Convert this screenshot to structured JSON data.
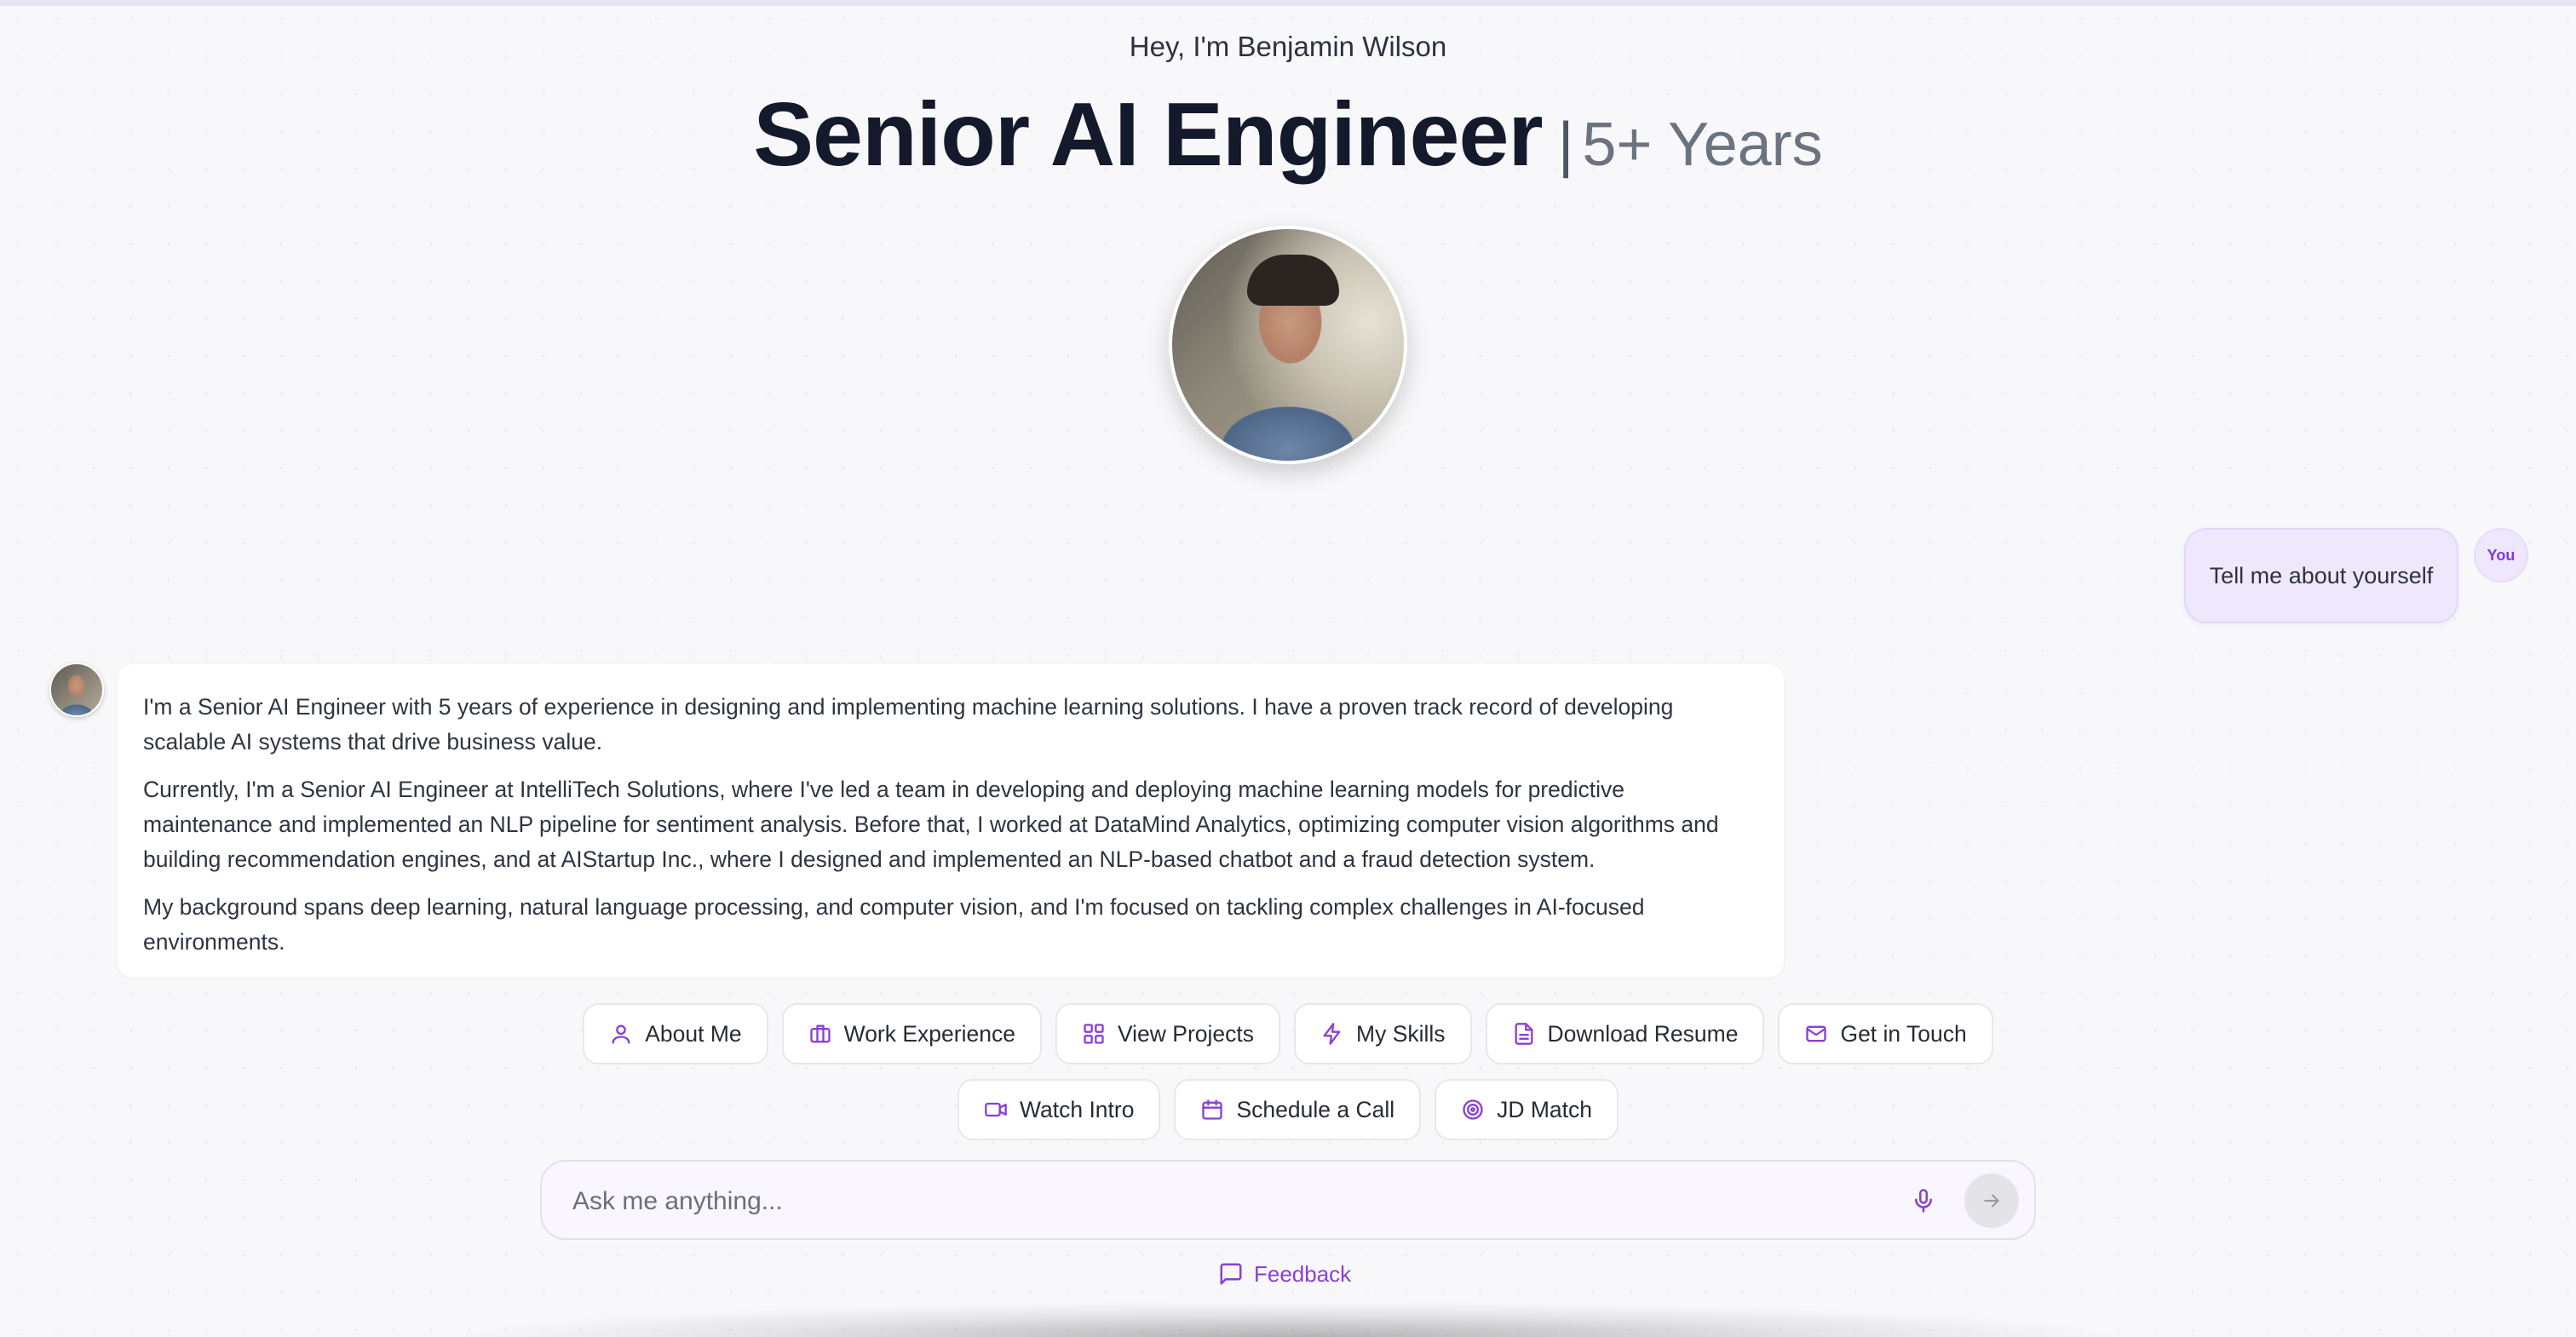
{
  "header": {
    "greeting": "Hey, I'm Benjamin Wilson",
    "role": "Senior AI Engineer",
    "separator": "|",
    "experience": "5+ Years"
  },
  "conversation": {
    "user_message": "Tell me about yourself",
    "user_badge": "You",
    "bot_paragraphs": [
      "I'm a Senior AI Engineer with 5 years of experience in designing and implementing machine learning solutions. I have a proven track record of developing scalable AI systems that drive business value.",
      "Currently, I'm a Senior AI Engineer at IntelliTech Solutions, where I've led a team in developing and deploying machine learning models for predictive maintenance and implemented an NLP pipeline for sentiment analysis. Before that, I worked at DataMind Analytics, optimizing computer vision algorithms and building recommendation engines, and at AIStartup Inc., where I designed and implemented an NLP-based chatbot and a fraud detection system.",
      "My background spans deep learning, natural language processing, and computer vision, and I'm focused on tackling complex challenges in AI-focused environments."
    ]
  },
  "quick_actions": {
    "row1": [
      {
        "label": "About Me",
        "icon": "user-icon"
      },
      {
        "label": "Work Experience",
        "icon": "briefcase-icon"
      },
      {
        "label": "View Projects",
        "icon": "grid-icon"
      },
      {
        "label": "My Skills",
        "icon": "lightning-icon"
      },
      {
        "label": "Download Resume",
        "icon": "document-icon"
      },
      {
        "label": "Get in Touch",
        "icon": "mail-icon"
      }
    ],
    "row2": [
      {
        "label": "Watch Intro",
        "icon": "video-icon"
      },
      {
        "label": "Schedule a Call",
        "icon": "calendar-icon"
      },
      {
        "label": "JD Match",
        "icon": "target-icon"
      }
    ]
  },
  "composer": {
    "placeholder": "Ask me anything...",
    "mic_icon": "microphone-icon",
    "send_icon": "arrow-right-icon"
  },
  "footer": {
    "feedback_label": "Feedback",
    "feedback_icon": "message-icon"
  },
  "colors": {
    "accent": "#8b3fd6",
    "user_bubble": "#efe8fd",
    "background": "#f8f8fa"
  }
}
